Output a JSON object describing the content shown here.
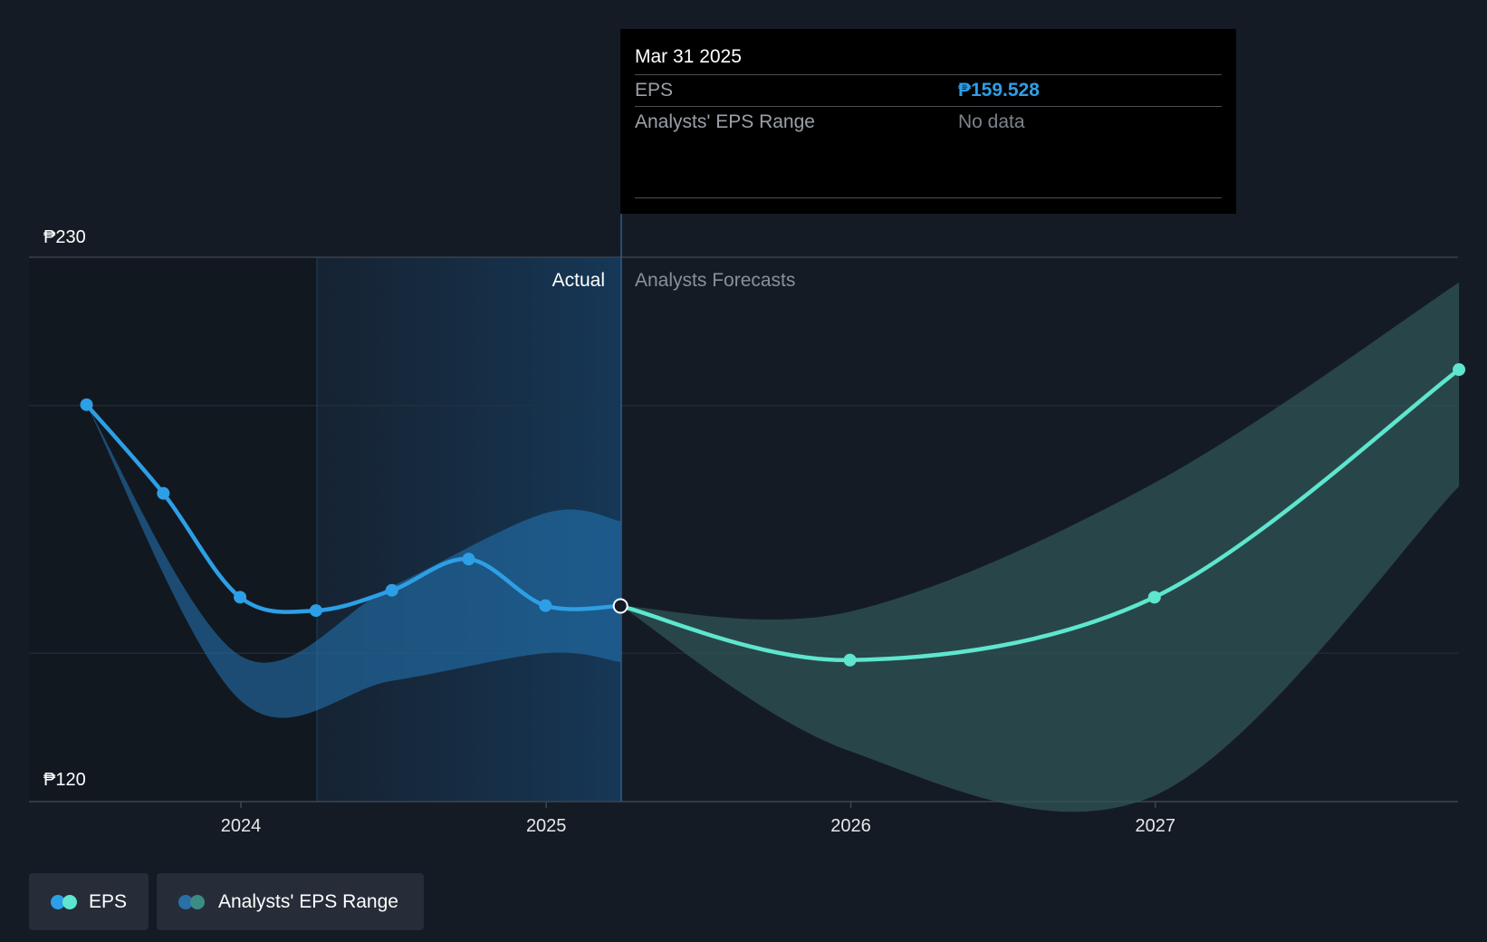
{
  "chart_data": {
    "type": "line",
    "title": "",
    "currency": "₱",
    "y_axis": {
      "min": 120,
      "max": 230,
      "labels": [
        "₱230",
        "₱120"
      ],
      "gridlines": [
        200,
        150
      ]
    },
    "x_axis": {
      "ticks": [
        "2024",
        "2025",
        "2026",
        "2027"
      ]
    },
    "regions": {
      "actual_label": "Actual",
      "forecast_label": "Analysts Forecasts",
      "divider_date": "2025-03-31"
    },
    "series": [
      {
        "name": "EPS",
        "kind": "actual",
        "color": "#2d9fe6",
        "points": [
          {
            "date": "2023-06-30",
            "value": 200.2
          },
          {
            "date": "2023-09-30",
            "value": 182.3
          },
          {
            "date": "2023-12-31",
            "value": 161.3
          },
          {
            "date": "2024-03-31",
            "value": 158.6
          },
          {
            "date": "2024-06-30",
            "value": 162.7
          },
          {
            "date": "2024-09-30",
            "value": 169.0
          },
          {
            "date": "2024-12-31",
            "value": 159.6
          },
          {
            "date": "2025-03-31",
            "value": 159.528
          }
        ]
      },
      {
        "name": "EPS",
        "kind": "forecast",
        "color": "#5ee6cf",
        "points": [
          {
            "date": "2025-03-31",
            "value": 159.528
          },
          {
            "date": "2025-12-31",
            "value": 148.6
          },
          {
            "date": "2026-12-31",
            "value": 161.3
          },
          {
            "date": "2027-12-31",
            "value": 207.3
          }
        ]
      }
    ],
    "ranges": [
      {
        "name": "Analysts' EPS Range",
        "kind": "actual",
        "color": "#2478b8",
        "upper": [
          {
            "date": "2023-06-30",
            "value": 200.2
          },
          {
            "date": "2023-12-31",
            "value": 149.5
          },
          {
            "date": "2024-06-30",
            "value": 163.5
          },
          {
            "date": "2024-12-31",
            "value": 178.3
          },
          {
            "date": "2025-03-31",
            "value": 176.7
          }
        ],
        "lower": [
          {
            "date": "2023-06-30",
            "value": 200.2
          },
          {
            "date": "2023-12-31",
            "value": 140.5
          },
          {
            "date": "2024-06-30",
            "value": 144.4
          },
          {
            "date": "2024-12-31",
            "value": 150.0
          },
          {
            "date": "2025-03-31",
            "value": 148.2
          }
        ]
      },
      {
        "name": "Analysts' EPS Range",
        "kind": "forecast",
        "color": "#2f5555",
        "upper": [
          {
            "date": "2025-03-31",
            "value": 159.528
          },
          {
            "date": "2025-12-31",
            "value": 158.4
          },
          {
            "date": "2026-12-31",
            "value": 184.4
          },
          {
            "date": "2027-12-31",
            "value": 224.9
          }
        ],
        "lower": [
          {
            "date": "2025-03-31",
            "value": 159.528
          },
          {
            "date": "2025-12-31",
            "value": 130.2
          },
          {
            "date": "2026-12-31",
            "value": 121.2
          },
          {
            "date": "2027-12-31",
            "value": 183.7
          }
        ]
      }
    ],
    "legend": [
      {
        "label": "EPS",
        "colors": [
          "#2d9fe6",
          "#5ee6cf"
        ]
      },
      {
        "label": "Analysts' EPS Range",
        "colors": [
          "#2a6fa6",
          "#3b8c84"
        ]
      }
    ]
  },
  "tooltip": {
    "date": "Mar 31 2025",
    "rows": [
      {
        "label": "EPS",
        "value": "₱159.528"
      },
      {
        "label": "Analysts' EPS Range",
        "value": "No data"
      }
    ]
  }
}
